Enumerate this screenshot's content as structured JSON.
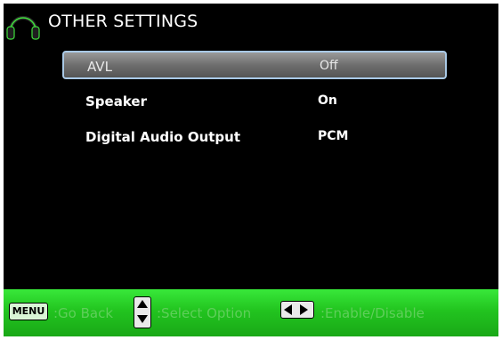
{
  "header": {
    "title": "OTHER SETTINGS",
    "icon": "headset-icon"
  },
  "menu": {
    "items": [
      {
        "label": "AVL",
        "value": "Off",
        "selected": true
      },
      {
        "label": "Speaker",
        "value": "On",
        "selected": false
      },
      {
        "label": "Digital Audio Output",
        "value": "PCM",
        "selected": false
      }
    ]
  },
  "footer": {
    "menu_key": "MENU",
    "go_back": ":Go Back",
    "select_option": ":Select Option",
    "enable_disable": ":Enable/Disable"
  },
  "colors": {
    "background": "#000000",
    "footer_green": "#22c41f",
    "selection_border": "#a9c9e6"
  }
}
